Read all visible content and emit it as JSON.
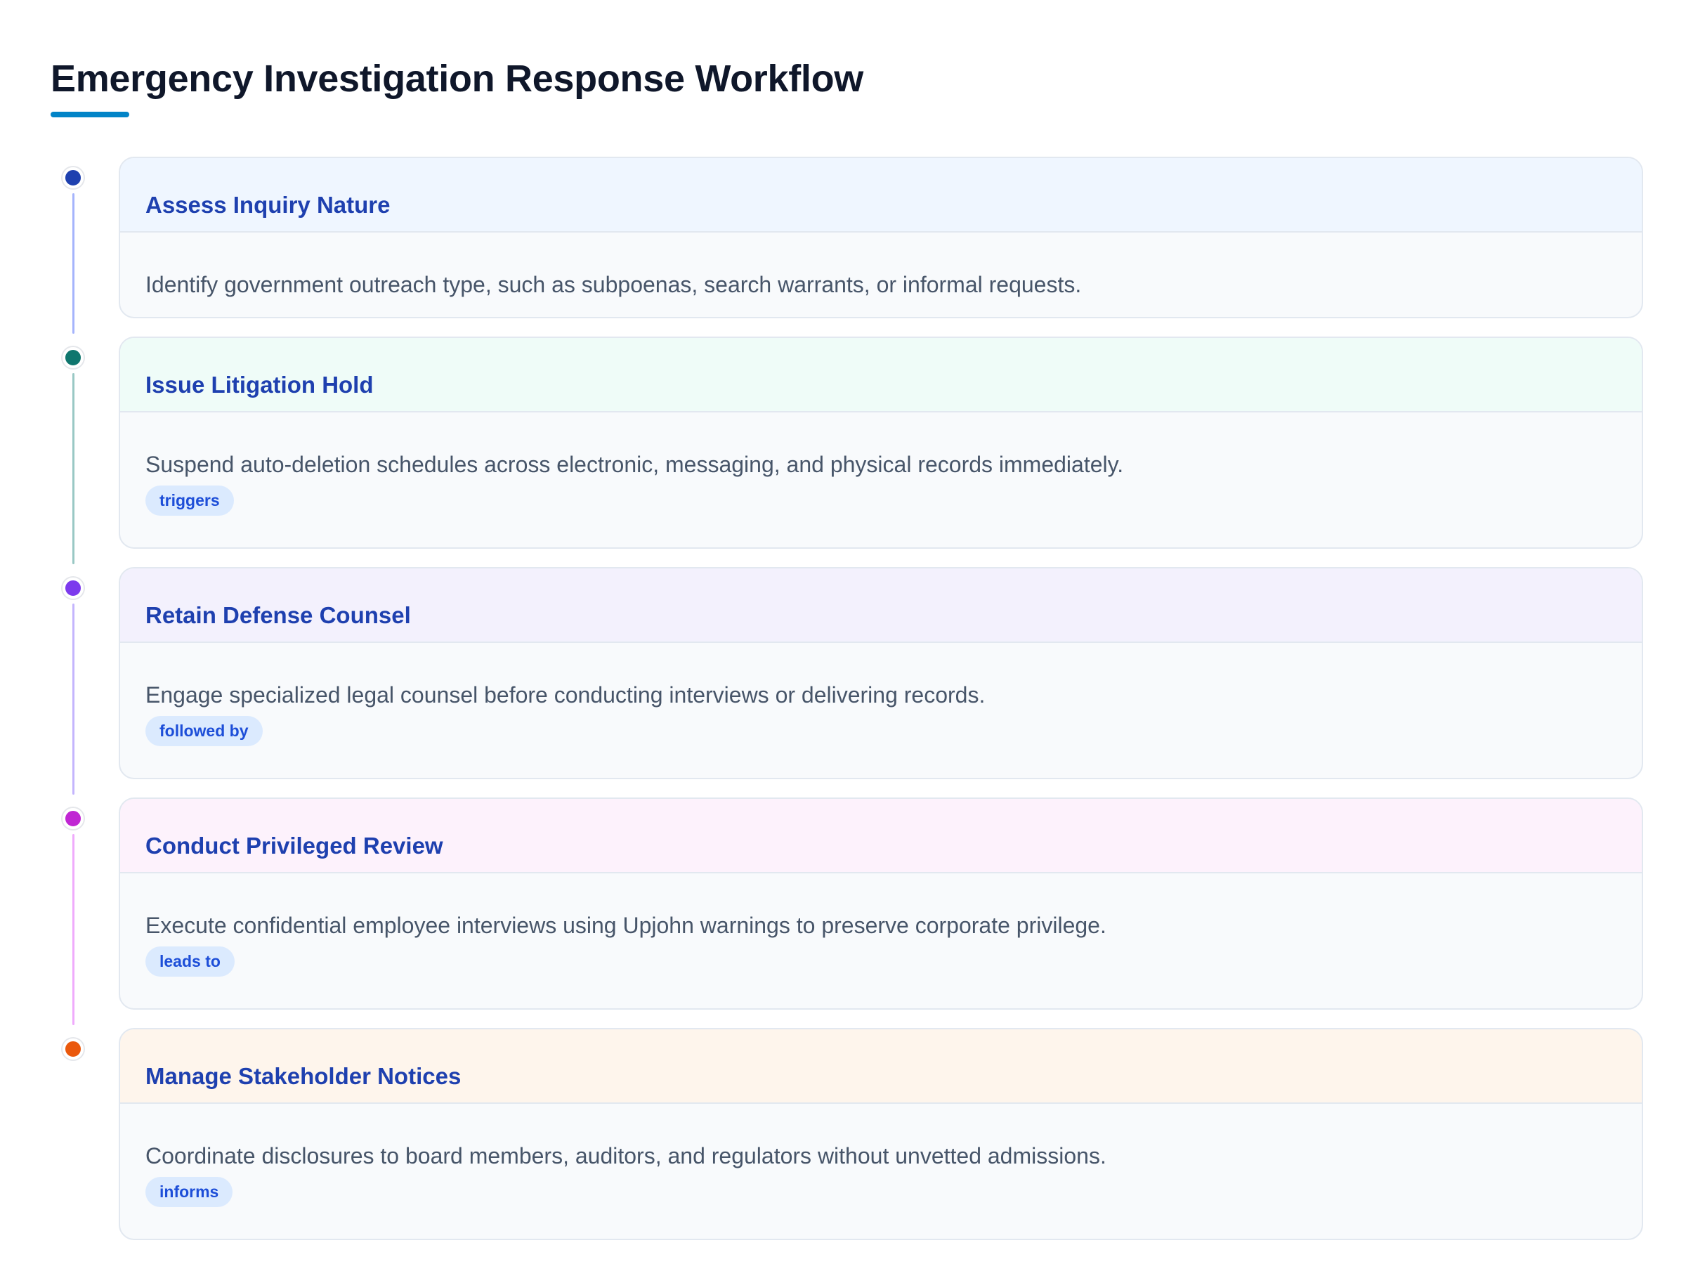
{
  "title": "Emergency Investigation Response Workflow",
  "steps": [
    {
      "title": "Assess Inquiry Nature",
      "description": "Identify government outreach type, such as subpoenas, search warrants, or informal requests.",
      "badge": "",
      "dot_color": "#1e40af",
      "line_color": "#a5b4fc",
      "header_bg": "#eff6ff"
    },
    {
      "title": "Issue Litigation Hold",
      "description": "Suspend auto-deletion schedules across electronic, messaging, and physical records immediately.",
      "badge": "triggers",
      "dot_color": "#0f766e",
      "line_color": "#99c8c4",
      "header_bg": "#effcf8"
    },
    {
      "title": "Retain Defense Counsel",
      "description": "Engage specialized legal counsel before conducting interviews or delivering records.",
      "badge": "followed by",
      "dot_color": "#7c3aed",
      "line_color": "#c4b5fd",
      "header_bg": "#f3f1fd"
    },
    {
      "title": "Conduct Privileged Review",
      "description": "Execute confidential employee interviews using Upjohn warnings to preserve corporate privilege.",
      "badge": "leads to",
      "dot_color": "#c026d3",
      "line_color": "#f0abfc",
      "header_bg": "#fdf2fc"
    },
    {
      "title": "Manage Stakeholder Notices",
      "description": "Coordinate disclosures to board members, auditors, and regulators without unvetted admissions.",
      "badge": "informs",
      "dot_color": "#ea580c",
      "line_color": "",
      "header_bg": "#fef5ec"
    }
  ]
}
